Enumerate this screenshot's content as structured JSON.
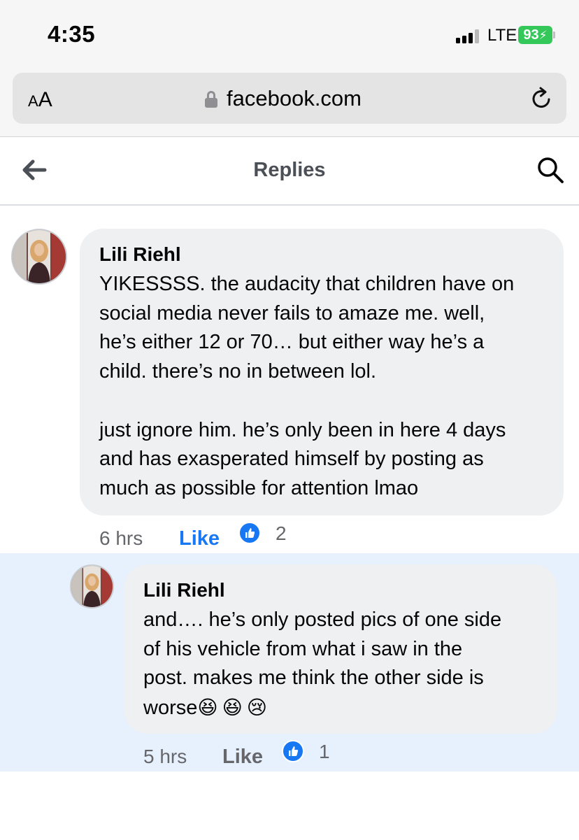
{
  "status_bar": {
    "time": "4:35",
    "network": "LTE",
    "battery": "93"
  },
  "browser": {
    "text_size_label_small": "A",
    "text_size_label_large": "A",
    "url": "facebook.com",
    "icons": [
      "lock-icon",
      "reload-icon"
    ]
  },
  "header": {
    "title": "Replies",
    "icons": [
      "back-arrow-icon",
      "search-icon"
    ]
  },
  "comments": [
    {
      "author": "Lili Riehl",
      "text": "YIKESSSS. the audacity that children have on\nsocial media never fails to amaze me. well,\nhe’s either 12 or 70… but either way he’s a\nchild. there’s no in between lol.\n\njust ignore him. he’s only been in here 4 days\nand has exasperated himself by posting as\nmuch as possible for attention lmao",
      "time": "6 hrs",
      "like_label": "Like",
      "like_state": "liked",
      "reaction_count": "2"
    },
    {
      "author": "Lili Riehl",
      "text": "and…. he’s only posted pics of one side\nof his vehicle from what i saw in the\npost. makes me think the other side is\nworse",
      "emojis": [
        "😆",
        "😆",
        "😢"
      ],
      "time": "5 hrs",
      "like_label": "Like",
      "like_state": "not-liked",
      "reaction_count": "1"
    }
  ],
  "colors": {
    "accent": "#1877f2",
    "bubble": "#eff0f2",
    "highlight": "#e7f0fd",
    "meta": "#65676b"
  }
}
